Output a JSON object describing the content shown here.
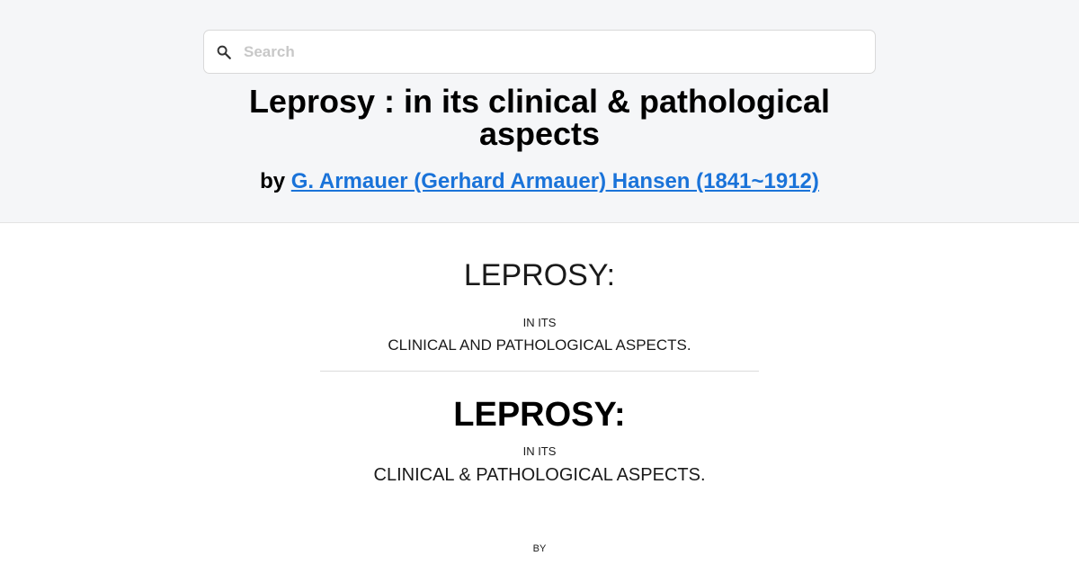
{
  "search": {
    "placeholder": "Search",
    "icon": "search-icon"
  },
  "book": {
    "title": "Leprosy : in its clinical & pathological aspects",
    "by_prefix": "by",
    "author": "G. Armauer (Gerhard Armauer) Hansen (1841~1912)"
  },
  "content": {
    "heading_1": "LEPROSY:",
    "subheading_1": "IN ITS",
    "line_1": "CLINICAL AND PATHOLOGICAL ASPECTS.",
    "heading_2": "LEPROSY:",
    "subheading_2": "IN ITS",
    "line_2": "CLINICAL & PATHOLOGICAL ASPECTS.",
    "by": "BY"
  },
  "colors": {
    "link": "#1a73d9",
    "header_bg": "#f5f6f8"
  }
}
